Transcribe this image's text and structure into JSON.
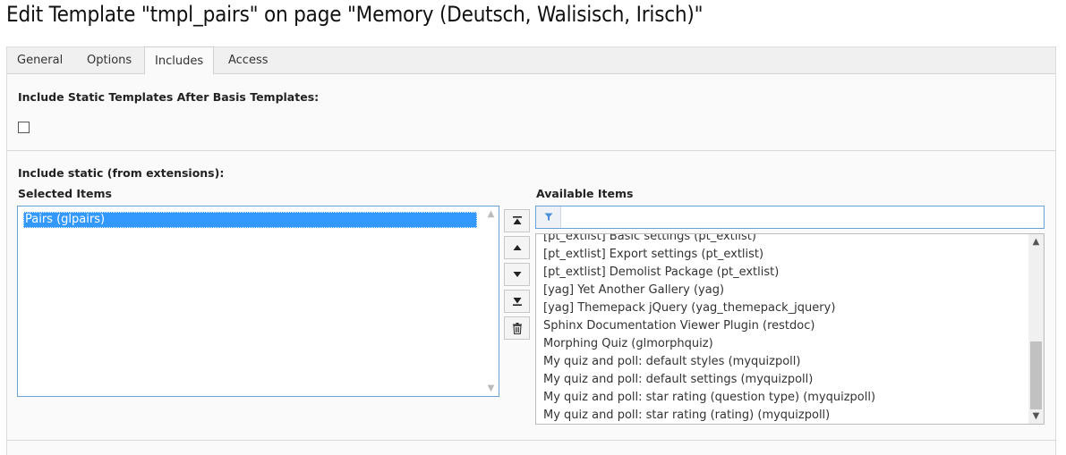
{
  "page": {
    "title": "Edit Template \"tmpl_pairs\" on page \"Memory (Deutsch, Walisisch, Irisch)\""
  },
  "tabs": [
    {
      "label": "General",
      "active": false
    },
    {
      "label": "Options",
      "active": false
    },
    {
      "label": "Includes",
      "active": true
    },
    {
      "label": "Access",
      "active": false
    }
  ],
  "static_templates": {
    "label": "Include Static Templates After Basis Templates:",
    "checked": false
  },
  "include_static": {
    "label": "Include static (from extensions):",
    "selected_header": "Selected Items",
    "available_header": "Available Items",
    "selected_items": [
      "Pairs (glpairs)"
    ],
    "filter_placeholder": "",
    "filter_value": "",
    "available_items": [
      "[pt_extlist] Basic settings (pt_extlist)",
      "[pt_extlist] Export settings (pt_extlist)",
      "[pt_extlist] Demolist Package (pt_extlist)",
      "[yag] Yet Another Gallery (yag)",
      "[yag] Themepack jQuery (yag_themepack_jquery)",
      "Sphinx Documentation Viewer Plugin (restdoc)",
      "Morphing Quiz (glmorphquiz)",
      "My quiz and poll: default styles (myquizpoll)",
      "My quiz and poll: default settings (myquizpoll)",
      "My quiz and poll: star rating (question type) (myquizpoll)",
      "My quiz and poll: star rating (rating) (myquizpoll)"
    ],
    "controls": [
      "move-to-top-icon",
      "move-up-icon",
      "move-down-icon",
      "move-to-bottom-icon",
      "trash-icon"
    ]
  },
  "colors": {
    "selection": "#3399ff",
    "focus_border": "#6aa0d8",
    "filter_icon": "#4a8fd6"
  }
}
